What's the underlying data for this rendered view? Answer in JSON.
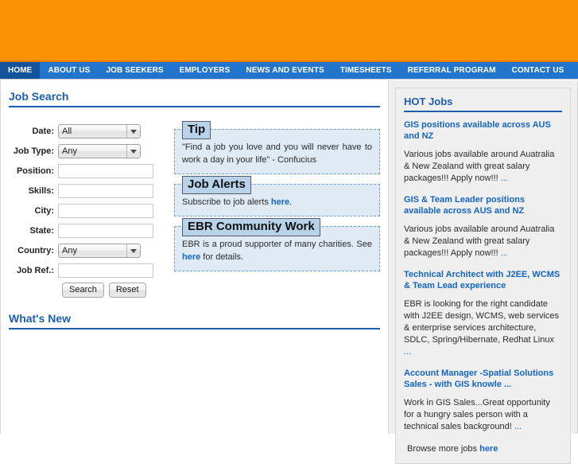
{
  "header": {
    "banner_color": "#fb9203",
    "banner_accent": "#e8780a"
  },
  "nav": {
    "accent_color": "#2175cc",
    "active_color": "#14549c",
    "items": [
      {
        "label": "HOME",
        "active": true
      },
      {
        "label": "ABOUT US",
        "active": false
      },
      {
        "label": "JOB SEEKERS",
        "active": false
      },
      {
        "label": "EMPLOYERS",
        "active": false
      },
      {
        "label": "NEWS AND EVENTS",
        "active": false
      },
      {
        "label": "TIMESHEETS",
        "active": false
      },
      {
        "label": "REFERRAL PROGRAM",
        "active": false
      },
      {
        "label": "CONTACT US",
        "active": false
      }
    ]
  },
  "main": {
    "job_search": {
      "heading": "Job Search",
      "fields": [
        {
          "label": "Date:",
          "type": "select",
          "value": "All"
        },
        {
          "label": "Job Type:",
          "type": "select",
          "value": "Any"
        },
        {
          "label": "Position:",
          "type": "text",
          "value": ""
        },
        {
          "label": "Skills:",
          "type": "text",
          "value": ""
        },
        {
          "label": "City:",
          "type": "text",
          "value": ""
        },
        {
          "label": "State:",
          "type": "text",
          "value": ""
        },
        {
          "label": "Country:",
          "type": "select",
          "value": "Any"
        },
        {
          "label": "Job Ref.:",
          "type": "text",
          "value": ""
        }
      ],
      "search_button": "Search",
      "reset_button": "Reset"
    },
    "info_boxes": [
      {
        "title": "Tip",
        "text": "\"Find a job you love and you will never have to work a day in your life\" - Confucius"
      },
      {
        "title": "Job Alerts",
        "text_before": "Subscribe to job alerts ",
        "link": "here",
        "text_after": "."
      },
      {
        "title": "EBR Community Work",
        "text_before": "EBR is a proud supporter of many charities. See ",
        "link": "here",
        "text_after": " for details."
      }
    ],
    "whats_new": {
      "heading": "What's New"
    }
  },
  "sidebar": {
    "heading": "HOT Jobs",
    "jobs": [
      {
        "title": "GIS positions available across AUS and NZ",
        "description": "Various jobs available around Auatralia & New Zealand with great salary packages!!! Apply now!!! ",
        "ellipsis": "..."
      },
      {
        "title": "GIS & Team Leader positions available across AUS and NZ",
        "description": "Various jobs available around Auatralia & New Zealand with great salary packages!!! Apply now!!! ",
        "ellipsis": "..."
      },
      {
        "title": "Technical Architect with J2EE, WCMS & Team Lead experience",
        "description": "EBR is looking for the right candidate with J2EE design, WCMS, web services & enterprise services architecture, SDLC, Spring/Hibernate, Redhat Linux ",
        "ellipsis": "..."
      },
      {
        "title": "Account Manager -Spatial Solutions Sales - with GIS knowle ...",
        "description": "Work in GIS Sales...Great opportunity for a hungry sales person with a technical sales background! ",
        "ellipsis": "..."
      }
    ],
    "browse_more_text": "Browse more jobs ",
    "browse_more_link": "here"
  }
}
